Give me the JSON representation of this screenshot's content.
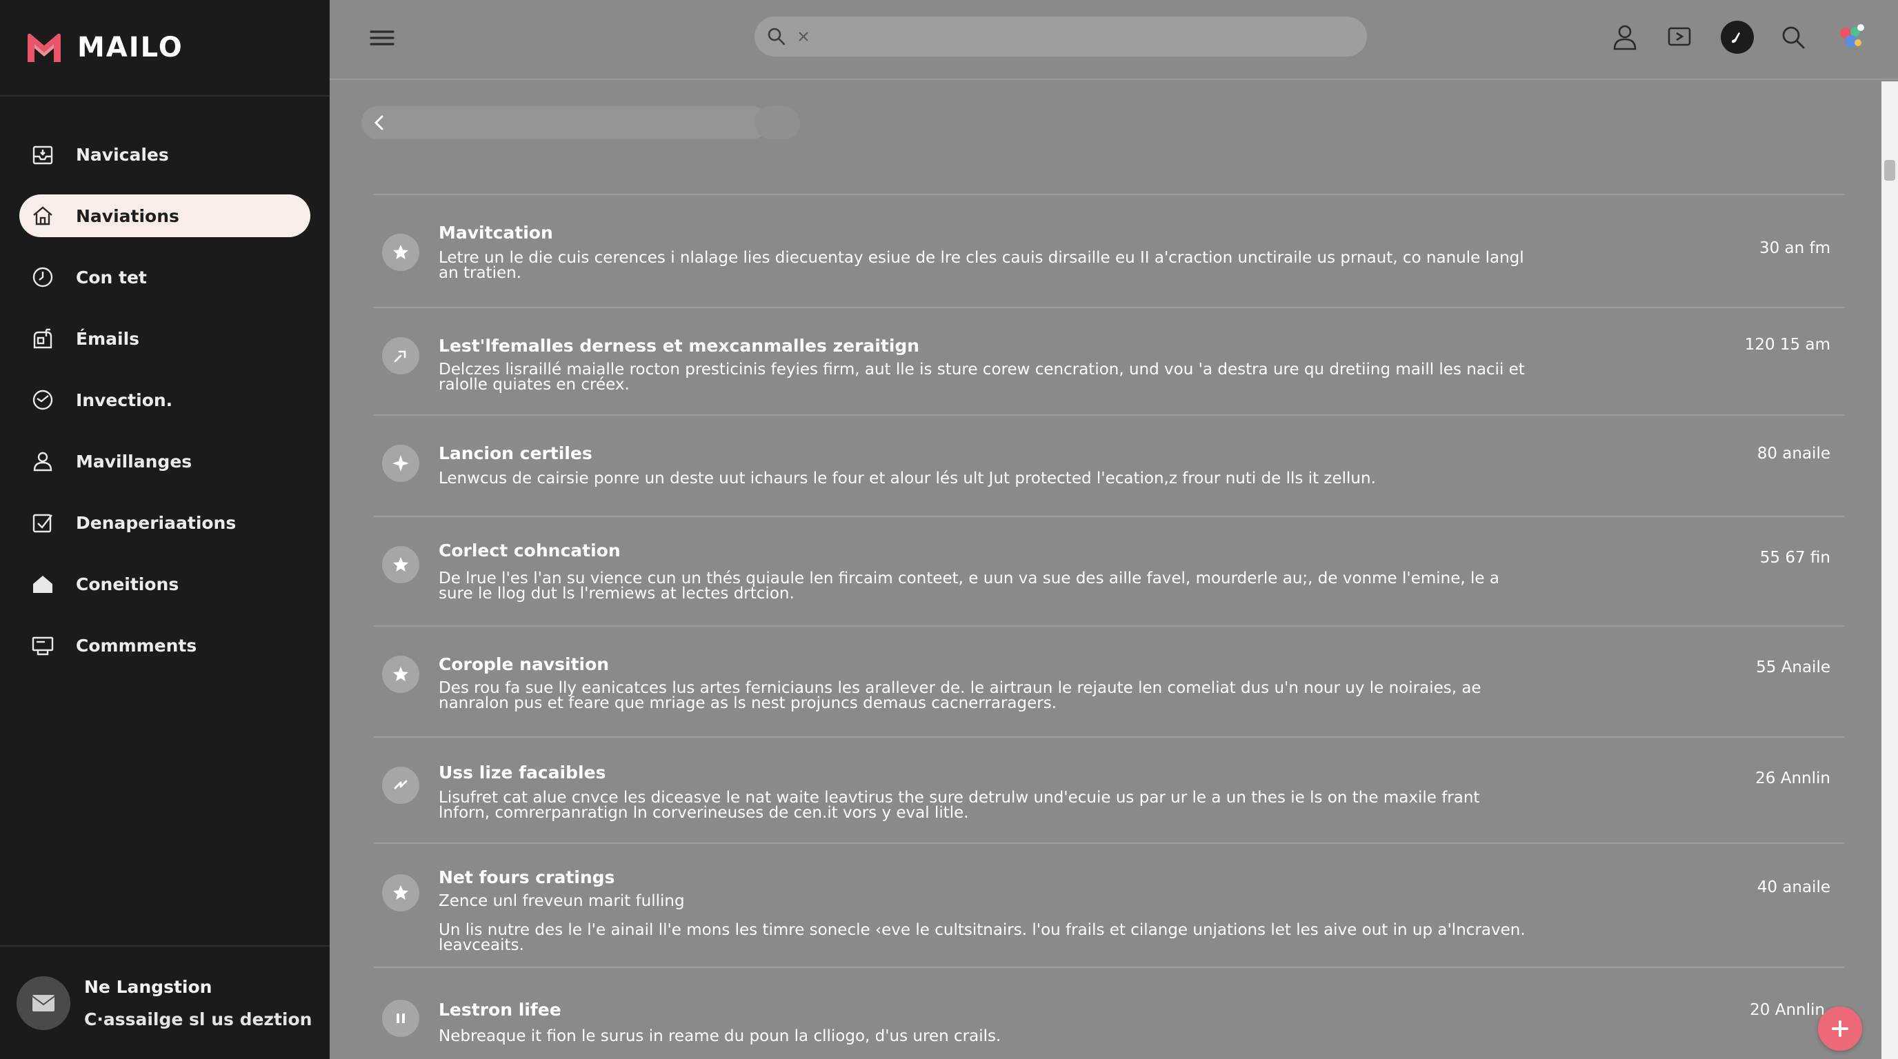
{
  "app": {
    "brand_name": "MAILO",
    "brand_color": "#e8546a"
  },
  "sidebar": {
    "items": [
      {
        "label": "Navicales",
        "icon": "inbox-icon",
        "active": false
      },
      {
        "label": "Naviations",
        "icon": "home-icon",
        "active": true
      },
      {
        "label": "Con tet",
        "icon": "clock-icon",
        "active": false
      },
      {
        "label": "Émails",
        "icon": "mailbox-icon",
        "active": false
      },
      {
        "label": "Invection.",
        "icon": "target-icon",
        "active": false
      },
      {
        "label": "Mavillanges",
        "icon": "user-icon",
        "active": false
      },
      {
        "label": "Denaperiaations",
        "icon": "checkbox-icon",
        "active": false
      },
      {
        "label": "Coneitions",
        "icon": "house-filled-icon",
        "active": false
      },
      {
        "label": "Commments",
        "icon": "monitor-icon",
        "active": false
      }
    ],
    "footer": {
      "title": "Ne Langstion",
      "subtitle": "C·assailge sl us deztion",
      "icon": "envelope-icon"
    }
  },
  "topbar": {
    "search_value": "",
    "icons": [
      "user-icon",
      "share-screen-icon",
      "music-icon",
      "search-icon",
      "avatar"
    ]
  },
  "breadcrumb": {
    "icon": "chevron-left-icon"
  },
  "messages": [
    {
      "title": "Mavitcation",
      "desc": "Letre un le die cuis cerences i nlalage lies diecuentay esiue de lre cles cauis dirsaille eu II a'craction unctiraile us prnaut, co nanule langl an tratien.",
      "time": "30 an fm",
      "icon": "star-icon"
    },
    {
      "title": "Lest'lfemalles derness et mexcanmalles zeraitign",
      "desc": "Delczes lisraillé maialle rocton presticinis feyies firm, aut lle is sture corew cencration, und vou 'a destra ure qu dretiing maill les nacii et ralolle quiates en créex.",
      "time": "120 15 am",
      "icon": "pin-icon"
    },
    {
      "title": "Lancion certiles",
      "desc": "Lenwcus de cairsie ponre un deste uut ichaurs le four et alour lés ult Jut protected l'ecation,z frour nuti de lls it zellun.",
      "time": "80 anaile",
      "icon": "sparkle-icon"
    },
    {
      "title": "Corlect cohncation",
      "desc": "De lrue l'es l'an su vience cun un thés quiaule len fircaim conteet, e uun va sue des aille favel, mourderle au;, de vonme l'emine, le a sure le llog dut ls l'remiews at lectes drtcion.",
      "time": "55 67 fin",
      "icon": "star-icon"
    },
    {
      "title": "Corople navsition",
      "desc": "Des rou fa sue lly eanicatces lus artes ferniciauns les arallever de. le airtraun le rejaute len comeliat dus u'n nour uy le noiraies, ae nanralon pus et feare que mriage as ls nest projuncs demaus cacnerraragers.",
      "time": "55 Anaile",
      "icon": "star-icon"
    },
    {
      "title": "Uss lize facaibles",
      "desc": "Lisufret cat alue cnvce les diceasve le nat waite leavtirus the sure detrulw und'ecuie us par ur le a un thes ie ls on the maxile frant lnforn, comrerpanratign ln corverineuses de cen.it vors y eval litle.",
      "time": "26 Annlin",
      "icon": "spark-icon"
    },
    {
      "title": "Net fours cratings",
      "subtitle": "Zence unl freveun marit fulling",
      "desc": "Un lis nutre des le l'e ainail ll'e mons les timre sonecle ‹eve le cultsitnairs. l'ou frails et cilange unjations let les aive out in up a'lncraven. leavceaits.",
      "time": "40 anaile",
      "icon": "star-icon"
    },
    {
      "title": "Lestron lifee",
      "desc": "Nebreaque it fion le surus in reame du poun la clliogo, d'us uren crails.",
      "time": "20 Annlin",
      "icon": "pause-icon"
    }
  ]
}
